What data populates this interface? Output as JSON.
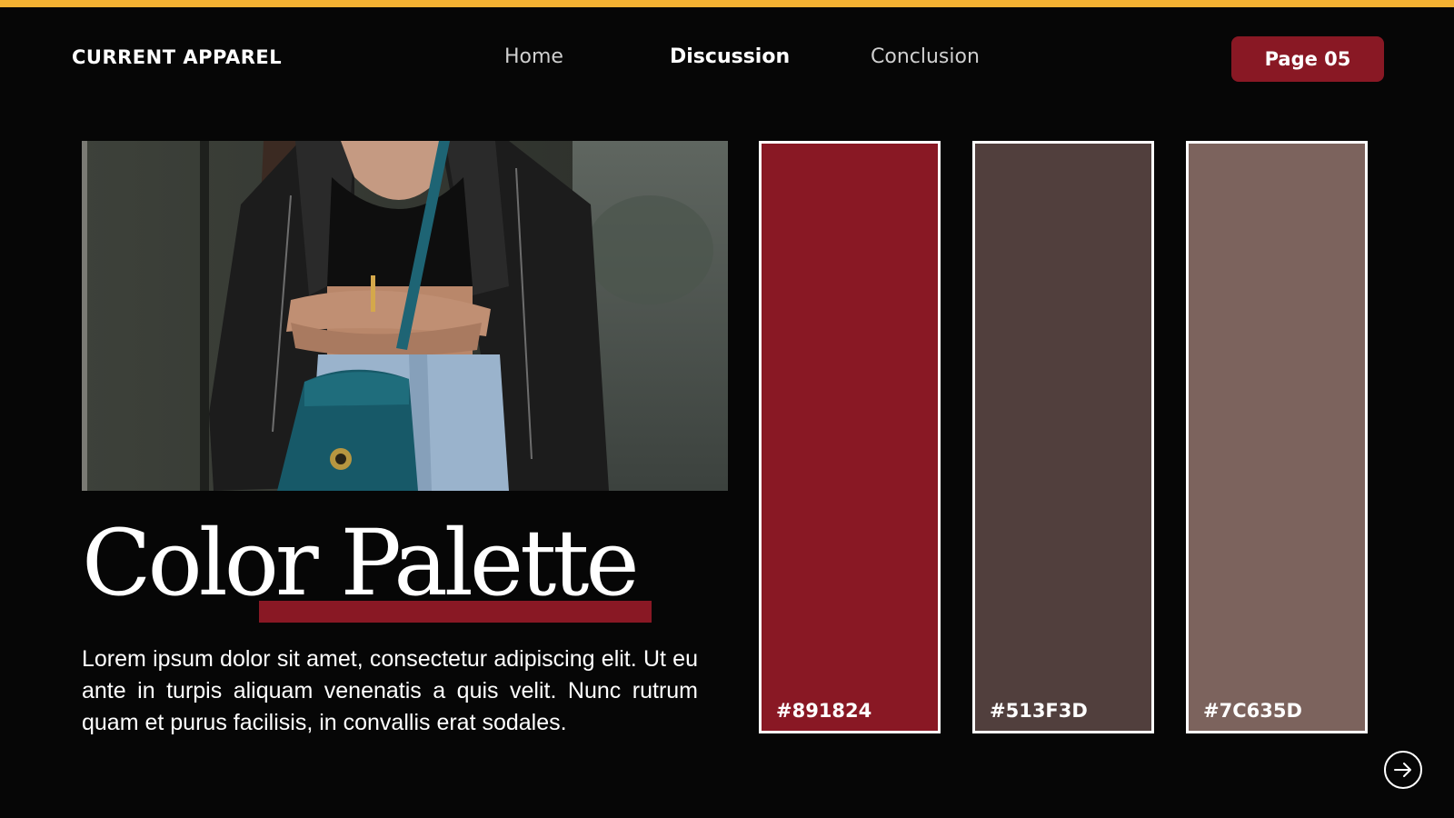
{
  "header": {
    "brand": "CURRENT APPAREL",
    "nav": [
      {
        "label": "Home",
        "active": false
      },
      {
        "label": "Discussion",
        "active": true
      },
      {
        "label": "Conclusion",
        "active": false
      }
    ],
    "page_badge": "Page 05"
  },
  "hero_image": {
    "icon": "photo-image"
  },
  "main": {
    "title": "Color Palette",
    "body": "Lorem ipsum dolor sit amet, consectetur adipiscing elit. Ut eu ante in turpis aliquam venenatis a quis velit. Nunc rutrum quam et purus facilisis, in convallis erat sodales."
  },
  "palette": [
    {
      "label": "#891824",
      "color": "#891824"
    },
    {
      "label": "#513F3D",
      "color": "#513F3D"
    },
    {
      "label": "#7C635D",
      "color": "#7C635D"
    }
  ],
  "colors": {
    "accent_bar": "#f3b132",
    "brand_red": "#891824",
    "background": "#060606"
  },
  "next_button": {
    "icon": "arrow-right-icon"
  }
}
